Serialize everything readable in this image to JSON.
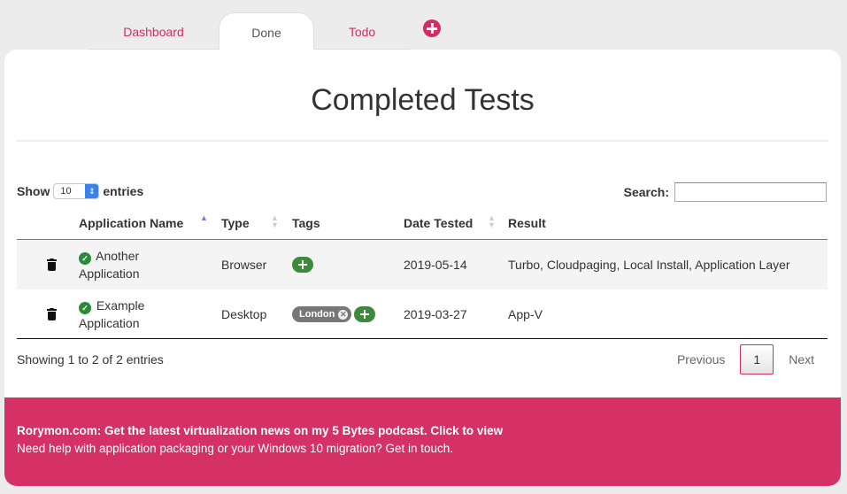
{
  "tabs": [
    {
      "label": "Dashboard",
      "active": false
    },
    {
      "label": "Done",
      "active": true
    },
    {
      "label": "Todo",
      "active": false
    }
  ],
  "add_tab_icon": "plus-circle-icon",
  "page_title": "Completed Tests",
  "length": {
    "prefix": "Show",
    "value": "10",
    "suffix": "entries"
  },
  "search": {
    "label": "Search:",
    "value": "",
    "placeholder": ""
  },
  "table": {
    "columns": [
      {
        "label": "Application Name",
        "sort": "ascending"
      },
      {
        "label": "Type",
        "sort": "none"
      },
      {
        "label": "Tags",
        "sort": null
      },
      {
        "label": "Date Tested",
        "sort": "none"
      },
      {
        "label": "Result",
        "sort": null
      }
    ],
    "rows": [
      {
        "name_line1": "Another",
        "name_line2": "Application",
        "status_icon": "check-circle-icon",
        "type": "Browser",
        "tags": [],
        "date": "2019-05-14",
        "result": "Turbo, Cloudpaging, Local Install, Application Layer"
      },
      {
        "name_line1": "Example",
        "name_line2": "Application",
        "status_icon": "check-circle-icon",
        "type": "Desktop",
        "tags": [
          "London"
        ],
        "date": "2019-03-27",
        "result": "App-V"
      }
    ]
  },
  "info": "Showing 1 to 2 of 2 entries",
  "pagination": {
    "previous": "Previous",
    "current": "1",
    "next": "Next"
  },
  "footer": {
    "line1": "Rorymon.com: Get the latest virtualization news on my 5 Bytes podcast. Click to view",
    "line2": "Need help with application packaging or your Windows 10 migration? Get in touch."
  },
  "colors": {
    "accent": "#d02d62",
    "footer_bg": "#d63166",
    "tag_add": "#3d8a3d",
    "check": "#2a8a3a",
    "sort_active": "#7879d8"
  }
}
